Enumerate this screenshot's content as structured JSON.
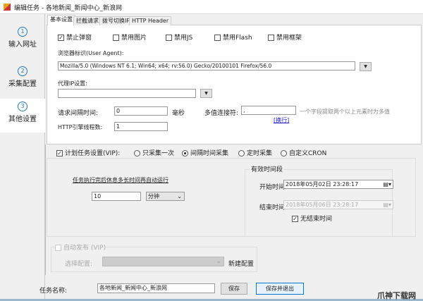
{
  "window": {
    "title": "编辑任务 - 各地新闻_新闻中心_新浪网"
  },
  "sidebar": {
    "steps": [
      {
        "num": "1",
        "label": "输入网址"
      },
      {
        "num": "2",
        "label": "采集配置"
      },
      {
        "num": "3",
        "label": "其他设置"
      }
    ]
  },
  "tabs": [
    "基本设置",
    "拦截请求",
    "拨号切换IP",
    "HTTP Header"
  ],
  "basic": {
    "checks": [
      {
        "label": "禁止弹窗",
        "checked": true
      },
      {
        "label": "禁用图片",
        "checked": false
      },
      {
        "label": "禁用JS",
        "checked": false
      },
      {
        "label": "禁用Flash",
        "checked": false
      },
      {
        "label": "禁用框架",
        "checked": false
      }
    ],
    "ua_label": "浏览器标识(User Agent):",
    "ua_value": "Mozilla/5.0 (Windows NT 6.1; Win64; x64; rv:56.0) Gecko/20100101 Firefox/56.0",
    "proxy_label": "代理IP设置:",
    "proxy_value": "",
    "interval_label": "请求间隔时间:",
    "interval_value": "0",
    "interval_unit": "毫秒",
    "joiner_label": "多值连接符:",
    "joiner_value": ",",
    "joiner_hint": "一个字段提取两个以上元素时为多值",
    "newline_link": "[换行]",
    "threads_label": "HTTP引擎线程数:",
    "threads_value": "1"
  },
  "schedule": {
    "label": "计划任务设置(VIP):",
    "checked": true,
    "options": [
      {
        "label": "只采集一次",
        "selected": false
      },
      {
        "label": "间隔时间采集",
        "selected": true
      },
      {
        "label": "定时采集",
        "selected": false
      },
      {
        "label": "自定义CRON",
        "selected": false
      }
    ],
    "rest_text": "任务执行完后休息多长时间再自动运行",
    "rest_value": "10",
    "rest_unit": "分钟",
    "period_title": "有效时间段",
    "start_label": "开始时间",
    "start_value": "2018年05月02日 23:28:17",
    "end_label": "结束时间",
    "end_value": "2018年05月06日 23:28:17",
    "no_end_label": "无结束时间",
    "no_end_checked": true
  },
  "publish": {
    "label": "自动发布 (VIP)",
    "select_label": "选择配置:",
    "select_value": "",
    "new_config": "新建配置"
  },
  "footer": {
    "name_label": "任务名称:",
    "name_value": "各地新闻_新闻中心_新浪网",
    "save": "保存",
    "save_exit": "保存并退出"
  },
  "watermark": "爪神下载网"
}
